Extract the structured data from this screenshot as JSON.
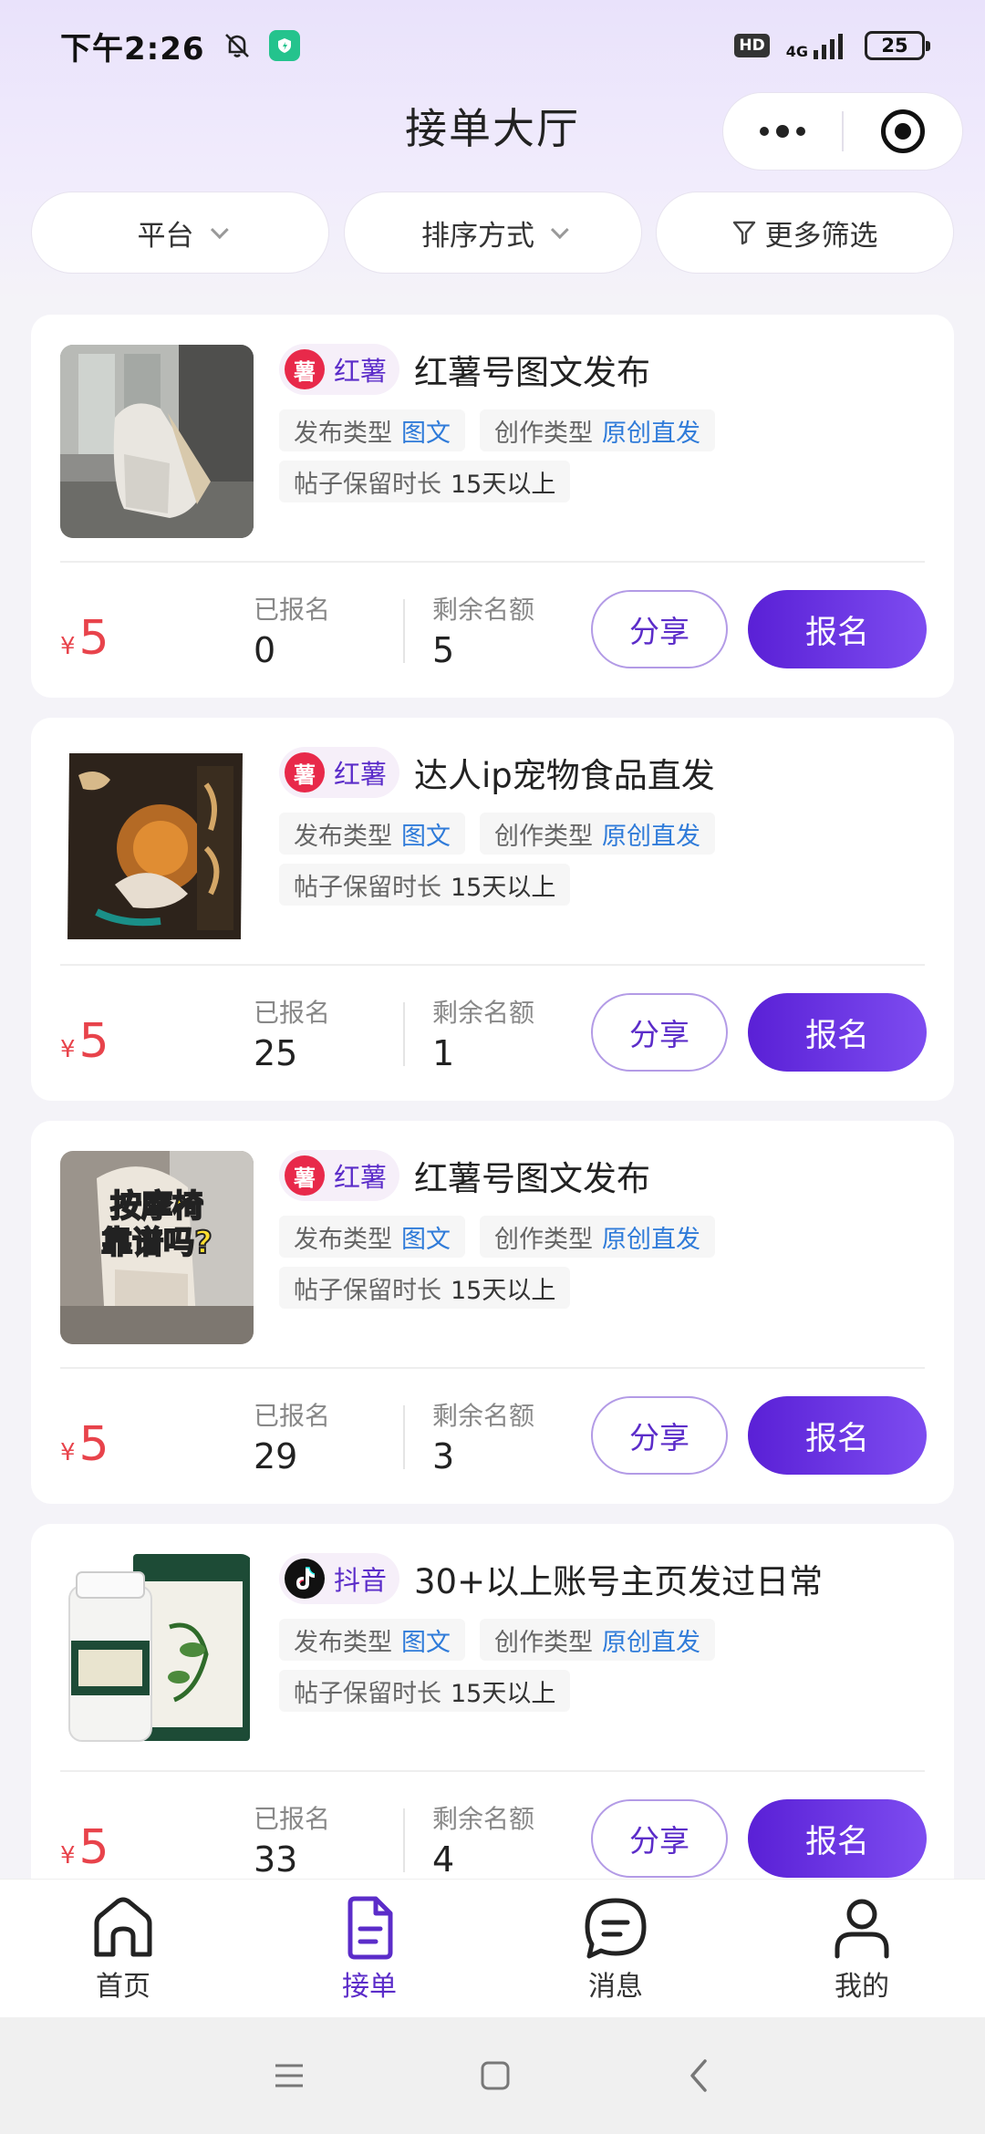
{
  "status_bar": {
    "time": "下午2:26",
    "hd": "HD",
    "network": "4G",
    "battery": "25"
  },
  "header": {
    "title": "接单大厅"
  },
  "filters": [
    {
      "label": "平台"
    },
    {
      "label": "排序方式"
    },
    {
      "label": "更多筛选"
    }
  ],
  "labels": {
    "publish_type": "发布类型",
    "create_type": "创作类型",
    "retention": "帖子保留时长",
    "signed_up": "已报名",
    "remaining": "剩余名额",
    "share": "分享",
    "signup": "报名",
    "currency": "¥"
  },
  "cards": [
    {
      "platform": "红薯",
      "platform_logo": "薯",
      "title": "红薯号图文发布",
      "publish_type": "图文",
      "create_type": "原创直发",
      "retention": "15天以上",
      "price": "5",
      "signed_up": "0",
      "remaining": "5"
    },
    {
      "platform": "红薯",
      "platform_logo": "薯",
      "title": "达人ip宠物食品直发",
      "publish_type": "图文",
      "create_type": "原创直发",
      "retention": "15天以上",
      "price": "5",
      "signed_up": "25",
      "remaining": "1"
    },
    {
      "platform": "红薯",
      "platform_logo": "薯",
      "title": "红薯号图文发布",
      "publish_type": "图文",
      "create_type": "原创直发",
      "retention": "15天以上",
      "price": "5",
      "signed_up": "29",
      "remaining": "3",
      "thumb_caption_1": "按摩椅",
      "thumb_caption_2": "靠谱吗?"
    },
    {
      "platform": "抖音",
      "title": "30+以上账号主页发过日常",
      "publish_type": "图文",
      "create_type": "原创直发",
      "retention": "15天以上",
      "price": "5",
      "signed_up": "33",
      "remaining": "4"
    }
  ],
  "tabs": [
    {
      "label": "首页",
      "icon": "home-icon"
    },
    {
      "label": "接单",
      "icon": "order-icon"
    },
    {
      "label": "消息",
      "icon": "message-icon"
    },
    {
      "label": "我的",
      "icon": "profile-icon"
    }
  ],
  "colors": {
    "accent": "#5b2cc9",
    "price": "#e8434b",
    "tag_value": "#2f7bd9",
    "xhs_red": "#e8294a"
  }
}
